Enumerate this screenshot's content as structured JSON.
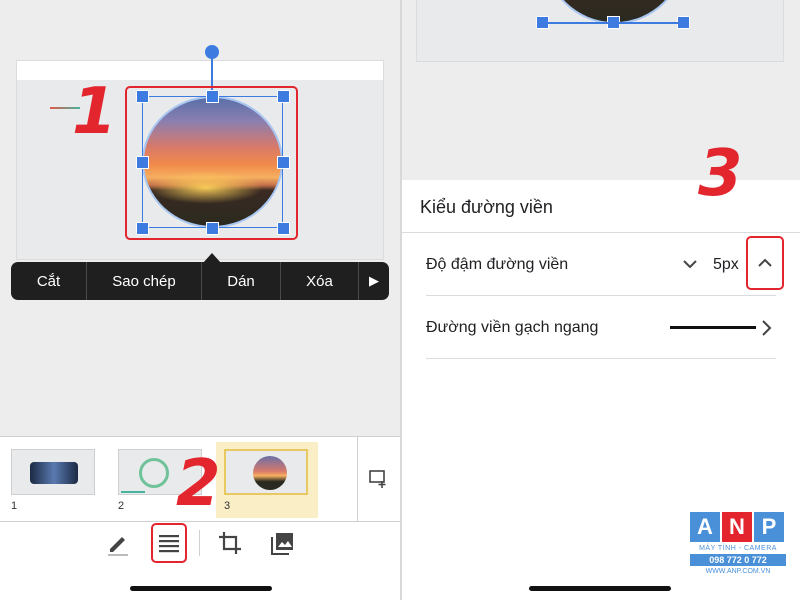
{
  "annotations": {
    "step1": "1",
    "step2": "2",
    "step3": "3"
  },
  "context_menu": {
    "items": [
      "Cắt",
      "Sao chép",
      "Dán",
      "Xóa"
    ],
    "more_icon": "play-triangle-icon"
  },
  "filmstrip": {
    "slides": [
      {
        "number": "1"
      },
      {
        "number": "2"
      },
      {
        "number": "3",
        "selected": true
      }
    ],
    "new_slide_icon": "new-slide-icon"
  },
  "toolbar": {
    "icons": [
      "pencil-icon",
      "format-lines-icon",
      "crop-icon",
      "image-icon"
    ]
  },
  "border_panel": {
    "title": "Kiểu đường viền",
    "weight_label": "Độ đậm đường viền",
    "weight_value": "5px",
    "dash_label": "Đường viền gạch ngang"
  },
  "logo": {
    "letters": [
      "A",
      "N",
      "P"
    ],
    "tagline": "MÁY TÍNH - CAMERA",
    "phone": "098 772 0 772",
    "website": "WWW.ANP.COM.VN"
  },
  "colors": {
    "accent_blue": "#3d7be0",
    "highlight_red": "#e3262e",
    "menu_bg": "#1f1f1f",
    "logo_blue": "#4a90d9",
    "logo_red": "#e3262e"
  }
}
